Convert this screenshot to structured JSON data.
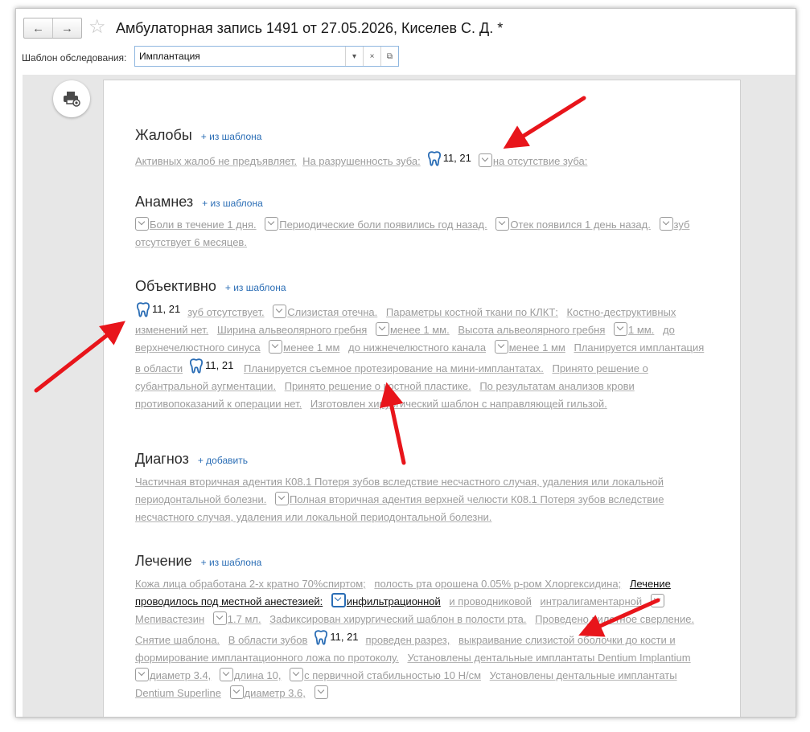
{
  "window": {
    "title": "Амбулаторная запись 1491 от 27.05.2026, Киселев С. Д. *",
    "back_icon": "←",
    "forward_icon": "→",
    "star_icon": "☆"
  },
  "template": {
    "label": "Шаблон обследования:",
    "value": "Имплантация",
    "dropdown_icon": "▾",
    "clear_icon": "×",
    "open_icon": "⧉"
  },
  "colors": {
    "accent": "#2a6db5",
    "phrase_gray": "#9c9c9c",
    "arrow": "#e8151b"
  },
  "teeth_label": "11, 21",
  "sections": {
    "complaints": {
      "title": "Жалобы",
      "add": "+ из шаблона",
      "items": [
        "Активных жалоб не предъявляет.",
        "На разрушенность зуба:",
        "на отсутствие зуба:"
      ]
    },
    "anamnesis": {
      "title": "Анамнез",
      "add": "+ из шаблона",
      "items": [
        "Боли в течение 1 дня.",
        "Периодические боли появились год назад.",
        "Отек появился 1 день назад.",
        "зуб отсутствует 6 месяцев."
      ]
    },
    "objective": {
      "title": "Объективно",
      "add": "+ из шаблона",
      "items": [
        "зуб отсутствует.",
        "Слизистая отечна.",
        "Параметры костной ткани по КЛКТ:",
        "Костно-деструктивных изменений нет.",
        "Ширина альвеолярного гребня",
        "менее 1 мм.",
        "Высота альвеолярного гребня",
        "1 мм.",
        "до верхнечелюстного синуса",
        "менее 1 мм",
        "до нижнечелюстного канала",
        "менее 1 мм",
        "Планируется имплантация в области",
        "Планируется съемное протезирование на мини-имплантатах.",
        "Принято решение о субантральной аугментации.",
        "Принято решение о костной пластике.",
        "По результатам анализов крови противопоказаний к операции нет.",
        "Изготовлен хирургический шаблон с направляющей гильзой."
      ]
    },
    "diagnosis": {
      "title": "Диагноз",
      "add": "+ добавить",
      "items": [
        "Частичная вторичная адентия К08.1 Потеря зубов вследствие несчастного случая, удаления или локальной периодонтальной болезни.",
        "Полная вторичная адентия верхней челюсти К08.1 Потеря зубов вследствие несчастного случая, удаления или локальной периодонтальной болезни."
      ]
    },
    "treatment": {
      "title": "Лечение",
      "add": "+ из шаблона",
      "items": [
        "Кожа лица обработана 2-х кратно 70%спиртом;",
        "полость рта орошена 0.05% р-ром Хлоргексидина;",
        "Лечение проводилось под местной анестезией:",
        "инфильтрационной",
        "и проводниковой",
        "интралигаментарной",
        "Мепивастезин",
        "1.7 мл.",
        "Зафиксирован хирургический шаблон в полости рта.",
        "Проведено пилотное сверление. Снятие шаблона.",
        "В области зубов",
        "проведен разрез,",
        "выкраивание слизистой оболочки до кости и формирование имплантационного ложа по протоколу.",
        "Установлены дентальные имплантаты Dentium Implantium",
        "диаметр 3.4,",
        "длина 10,",
        "с первичной стабильностью 10 Н/см",
        "Установлены дентальные имплантаты Dentium Superline",
        "диаметр 3.6,"
      ]
    }
  }
}
